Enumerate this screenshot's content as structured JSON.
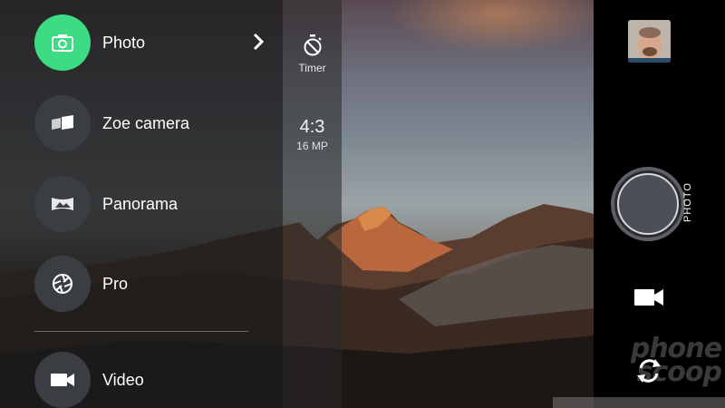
{
  "modes": [
    {
      "label": "Photo",
      "icon": "camera-icon",
      "active": true
    },
    {
      "label": "Zoe camera",
      "icon": "zoe-icon",
      "active": false
    },
    {
      "label": "Panorama",
      "icon": "panorama-icon",
      "active": false
    },
    {
      "label": "Pro",
      "icon": "aperture-icon",
      "active": false
    },
    {
      "label": "Video",
      "icon": "video-camera-icon",
      "active": false
    }
  ],
  "settings": {
    "timer_label": "Timer",
    "ratio": "4:3",
    "resolution": "16 MP"
  },
  "controls": {
    "current_mode": "PHOTO",
    "shutter_icon": "shutter-button",
    "video_icon": "video-camera-icon",
    "switch_icon": "switch-camera-icon"
  },
  "watermark": {
    "line1": "phone",
    "line2": "scoop"
  },
  "colors": {
    "active_mode": "#3ddc84",
    "mode_circle": "#3a3d42",
    "drawer_bg": "#1c1c1c",
    "panel_bg": "#000000"
  }
}
